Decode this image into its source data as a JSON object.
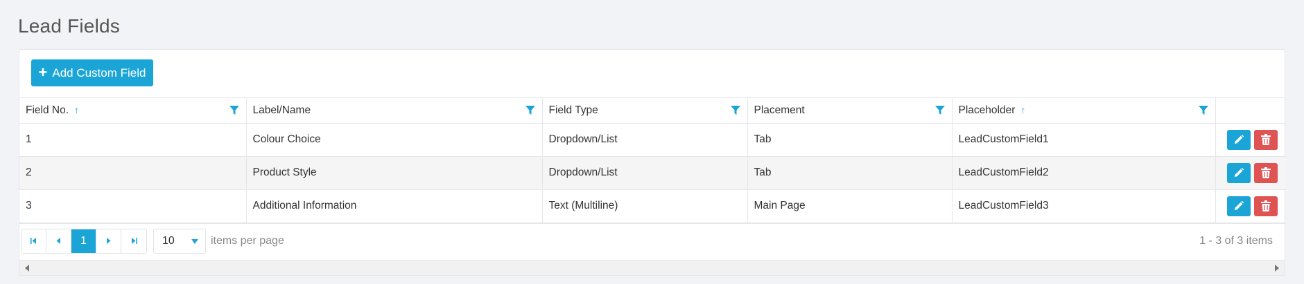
{
  "page": {
    "title": "Lead Fields"
  },
  "toolbar": {
    "add_label": "Add Custom Field"
  },
  "table": {
    "columns": [
      {
        "label": "Field No.",
        "sortable": true
      },
      {
        "label": "Label/Name",
        "sortable": false
      },
      {
        "label": "Field Type",
        "sortable": false
      },
      {
        "label": "Placement",
        "sortable": false
      },
      {
        "label": "Placeholder",
        "sortable": true
      }
    ],
    "rows": [
      {
        "no": "1",
        "name": "Colour Choice",
        "type": "Dropdown/List",
        "placement": "Tab",
        "placeholder": "LeadCustomField1"
      },
      {
        "no": "2",
        "name": "Product Style",
        "type": "Dropdown/List",
        "placement": "Tab",
        "placeholder": "LeadCustomField2"
      },
      {
        "no": "3",
        "name": "Additional Information",
        "type": "Text (Multiline)",
        "placement": "Main Page",
        "placeholder": "LeadCustomField3"
      }
    ]
  },
  "pager": {
    "current_page": "1",
    "page_size": "10",
    "per_page_label": "items per page",
    "range_info": "1 - 3 of 3 items"
  },
  "colors": {
    "accent": "#1ba5d7",
    "danger": "#e05353"
  }
}
